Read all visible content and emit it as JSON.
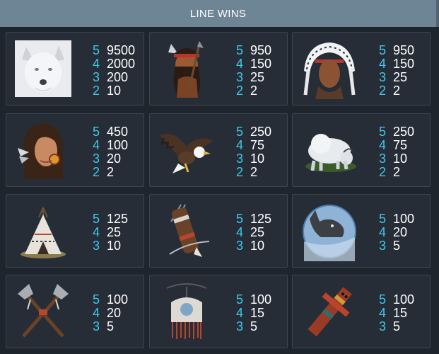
{
  "header": {
    "title": "LINE WINS"
  },
  "colors": {
    "count": "#3fc7eb",
    "value": "#ffffff",
    "header_bg": "#6e8596",
    "card_bg": "#262d37",
    "card_border": "#3b4553"
  },
  "symbols": [
    {
      "icon": "white-wolf-icon",
      "pays": [
        {
          "count": "5",
          "value": "9500"
        },
        {
          "count": "4",
          "value": "2000"
        },
        {
          "count": "3",
          "value": "200"
        },
        {
          "count": "2",
          "value": "10"
        }
      ]
    },
    {
      "icon": "native-warrior-icon",
      "pays": [
        {
          "count": "5",
          "value": "950"
        },
        {
          "count": "4",
          "value": "150"
        },
        {
          "count": "3",
          "value": "25"
        },
        {
          "count": "2",
          "value": "2"
        }
      ]
    },
    {
      "icon": "chief-headdress-icon",
      "pays": [
        {
          "count": "5",
          "value": "950"
        },
        {
          "count": "4",
          "value": "150"
        },
        {
          "count": "3",
          "value": "25"
        },
        {
          "count": "2",
          "value": "2"
        }
      ]
    },
    {
      "icon": "native-woman-icon",
      "pays": [
        {
          "count": "5",
          "value": "450"
        },
        {
          "count": "4",
          "value": "100"
        },
        {
          "count": "3",
          "value": "20"
        },
        {
          "count": "2",
          "value": "2"
        }
      ]
    },
    {
      "icon": "eagle-icon",
      "pays": [
        {
          "count": "5",
          "value": "250"
        },
        {
          "count": "4",
          "value": "75"
        },
        {
          "count": "3",
          "value": "10"
        },
        {
          "count": "2",
          "value": "2"
        }
      ]
    },
    {
      "icon": "white-buffalo-icon",
      "pays": [
        {
          "count": "5",
          "value": "250"
        },
        {
          "count": "4",
          "value": "75"
        },
        {
          "count": "3",
          "value": "10"
        },
        {
          "count": "2",
          "value": "2"
        }
      ]
    },
    {
      "icon": "teepee-icon",
      "pays": [
        {
          "count": "5",
          "value": "125"
        },
        {
          "count": "4",
          "value": "25"
        },
        {
          "count": "3",
          "value": "10"
        }
      ]
    },
    {
      "icon": "quiver-icon",
      "pays": [
        {
          "count": "5",
          "value": "125"
        },
        {
          "count": "4",
          "value": "25"
        },
        {
          "count": "3",
          "value": "10"
        }
      ]
    },
    {
      "icon": "wolf-moon-icon",
      "pays": [
        {
          "count": "5",
          "value": "100"
        },
        {
          "count": "4",
          "value": "20"
        },
        {
          "count": "3",
          "value": "5"
        }
      ]
    },
    {
      "icon": "crossed-tomahawks-icon",
      "pays": [
        {
          "count": "5",
          "value": "100"
        },
        {
          "count": "4",
          "value": "20"
        },
        {
          "count": "3",
          "value": "5"
        }
      ]
    },
    {
      "icon": "dreamcatcher-pouch-icon",
      "pays": [
        {
          "count": "5",
          "value": "100"
        },
        {
          "count": "4",
          "value": "15"
        },
        {
          "count": "3",
          "value": "5"
        }
      ]
    },
    {
      "icon": "totem-icon",
      "pays": [
        {
          "count": "5",
          "value": "100"
        },
        {
          "count": "4",
          "value": "15"
        },
        {
          "count": "3",
          "value": "5"
        }
      ]
    }
  ]
}
